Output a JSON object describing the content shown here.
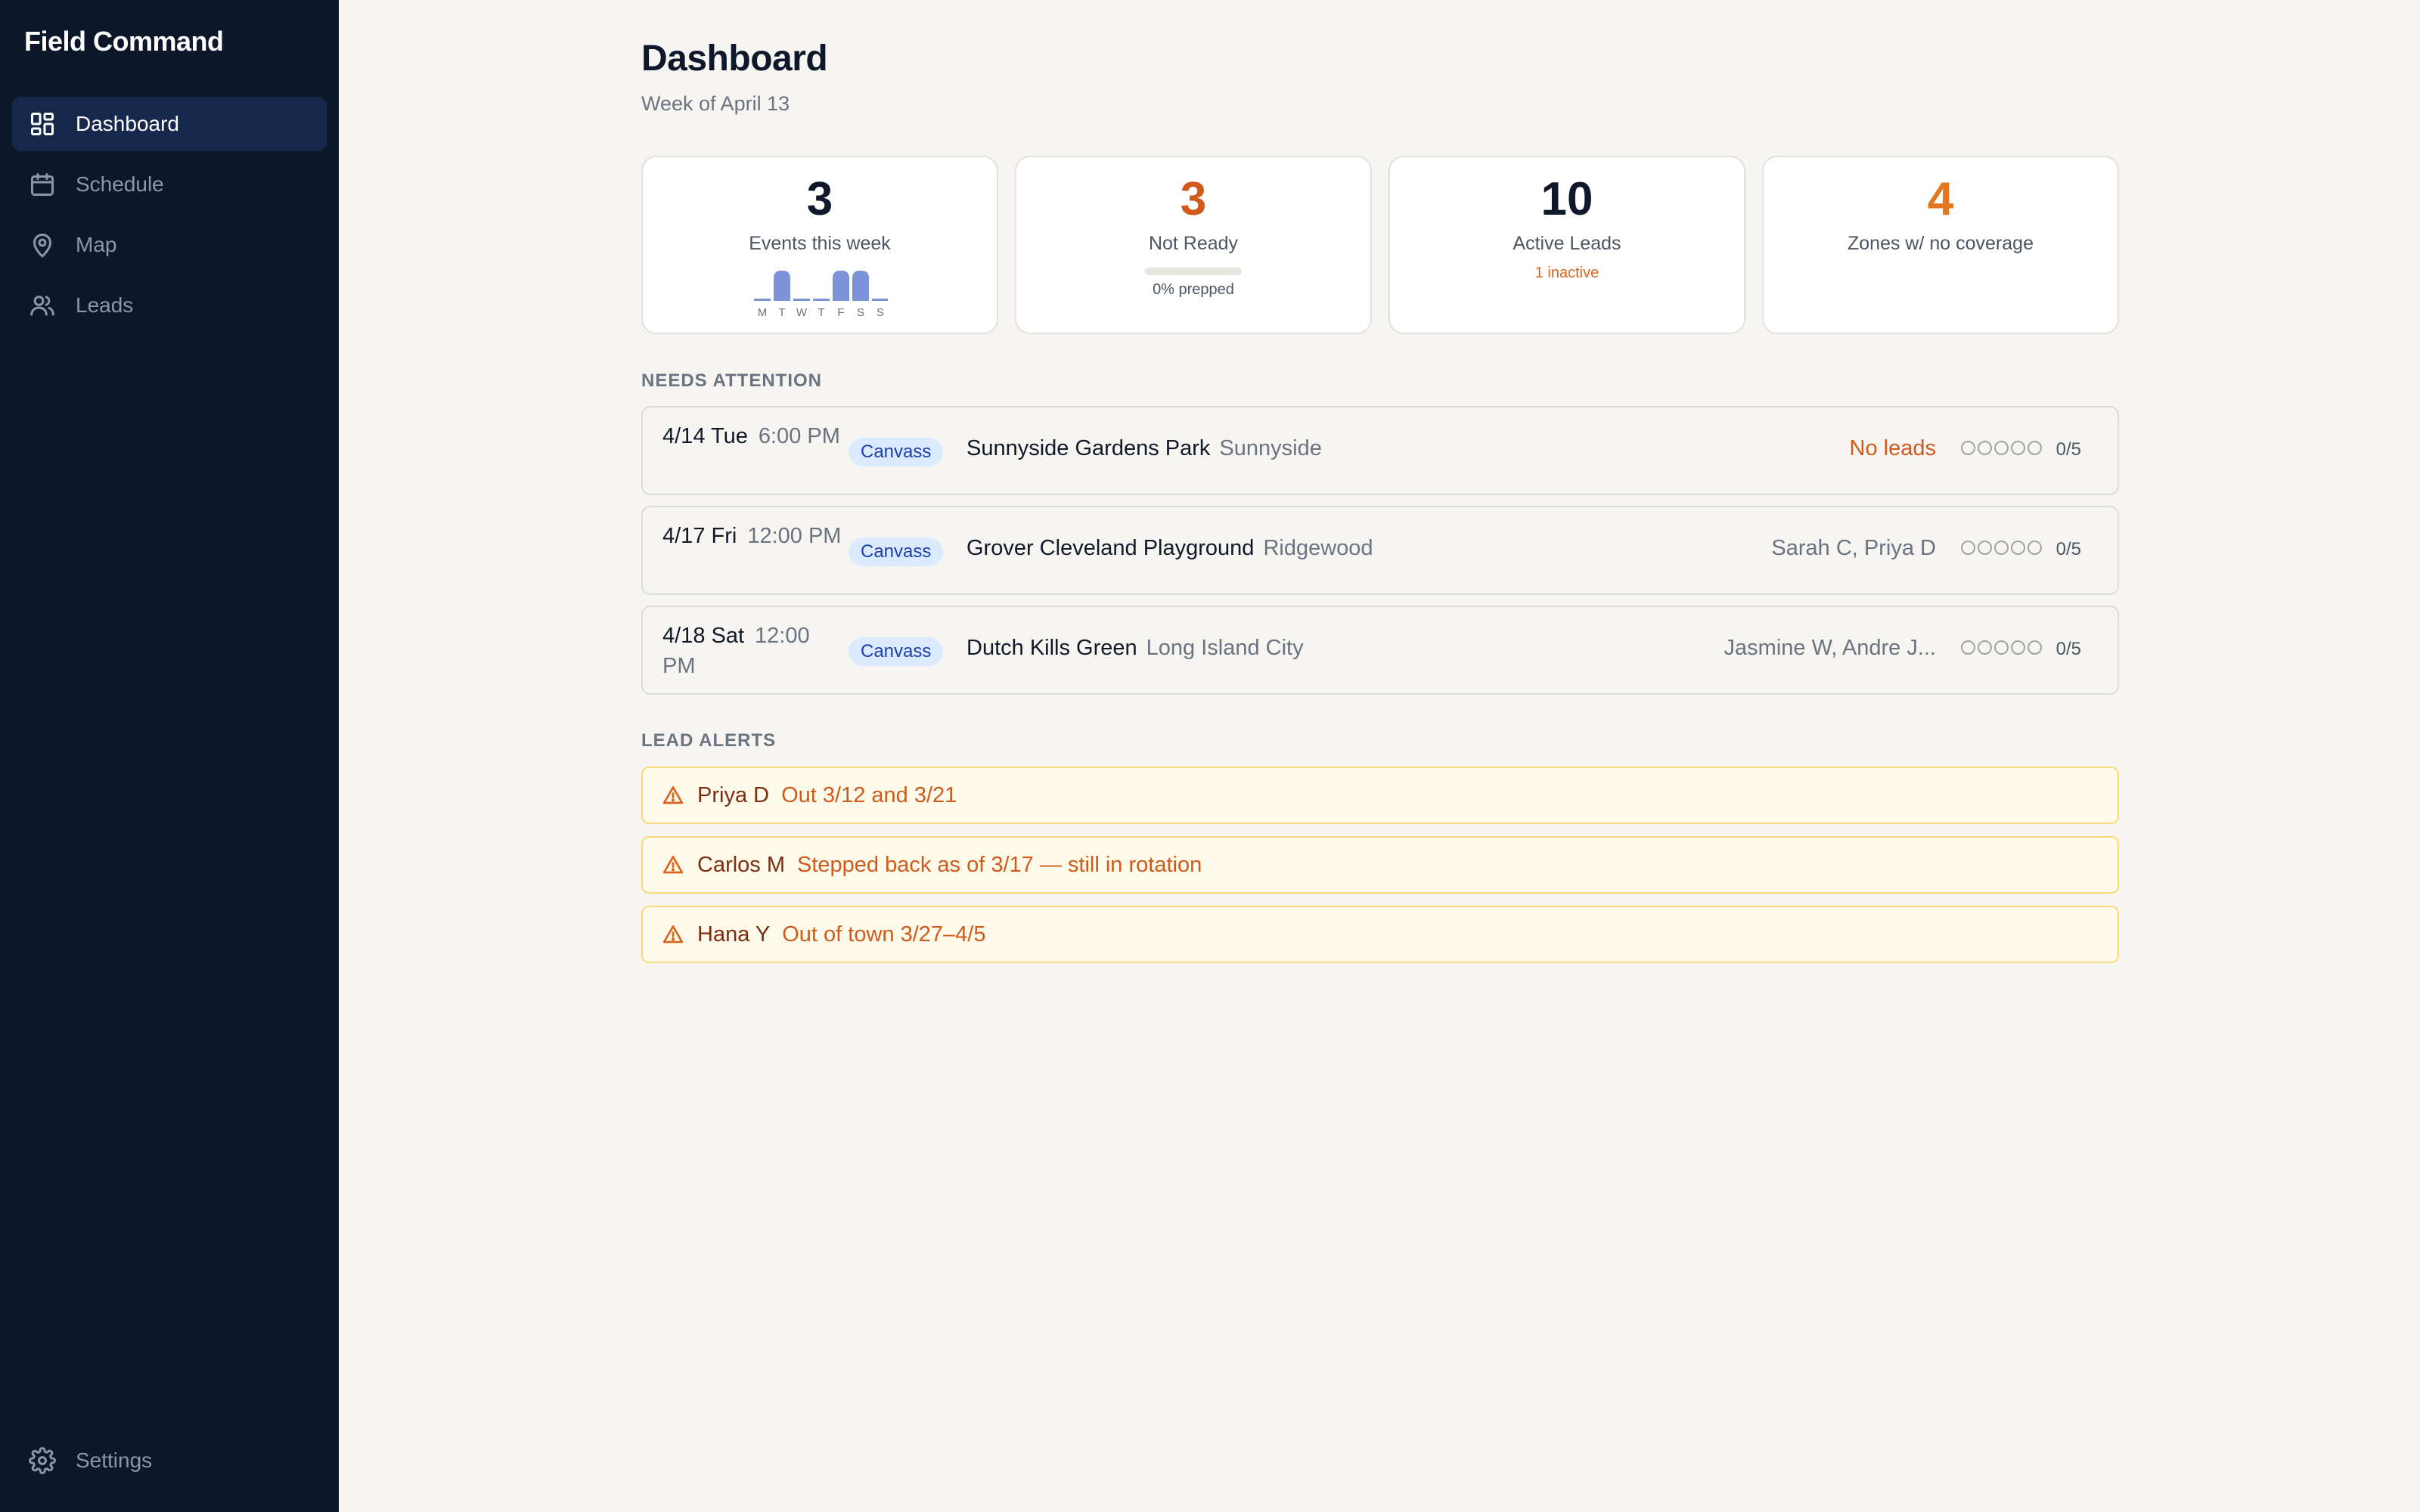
{
  "app": {
    "name": "Field Command"
  },
  "sidebar": {
    "items": [
      {
        "label": "Dashboard",
        "icon": "dashboard-icon",
        "active": true
      },
      {
        "label": "Schedule",
        "icon": "calendar-icon",
        "active": false
      },
      {
        "label": "Map",
        "icon": "map-pin-icon",
        "active": false
      },
      {
        "label": "Leads",
        "icon": "users-icon",
        "active": false
      }
    ],
    "settings_label": "Settings"
  },
  "header": {
    "title": "Dashboard",
    "subtitle": "Week of April 13"
  },
  "stats": {
    "events": {
      "value": "3",
      "label": "Events this week",
      "chart_data": {
        "type": "bar",
        "categories": [
          "M",
          "T",
          "W",
          "T",
          "F",
          "S",
          "S"
        ],
        "values": [
          0,
          1,
          0,
          0,
          1,
          1,
          0
        ]
      }
    },
    "not_ready": {
      "value": "3",
      "label": "Not Ready",
      "progress": 0,
      "progress_label": "0% prepped"
    },
    "active_leads": {
      "value": "10",
      "label": "Active Leads",
      "sub": "1 inactive"
    },
    "zones": {
      "value": "4",
      "label": "Zones w/ no coverage"
    }
  },
  "needs_attention": {
    "heading": "NEEDS ATTENTION",
    "events": [
      {
        "date": "4/14 Tue",
        "time": "6:00 PM",
        "tag": "Canvass",
        "venue": "Sunnyside Gardens Park",
        "neighborhood": "Sunnyside",
        "leads": "No leads",
        "leads_warn": true,
        "filled": 0,
        "score": "0/5"
      },
      {
        "date": "4/17 Fri",
        "time": "12:00 PM",
        "tag": "Canvass",
        "venue": "Grover Cleveland Playground",
        "neighborhood": "Ridgewood",
        "leads": "Sarah C, Priya D",
        "leads_warn": false,
        "filled": 0,
        "score": "0/5"
      },
      {
        "date": "4/18 Sat",
        "time": "12:00 PM",
        "tag": "Canvass",
        "venue": "Dutch Kills Green",
        "neighborhood": "Long Island City",
        "leads": "Jasmine W, Andre J...",
        "leads_warn": false,
        "filled": 0,
        "score": "0/5"
      }
    ]
  },
  "lead_alerts": {
    "heading": "LEAD ALERTS",
    "alerts": [
      {
        "name": "Priya D",
        "message": "Out 3/12 and 3/21"
      },
      {
        "name": "Carlos M",
        "message": "Stepped back as of 3/17 — still in rotation"
      },
      {
        "name": "Hana Y",
        "message": "Out of town 3/27–4/5"
      }
    ]
  },
  "colors": {
    "sidebar_bg": "#0d172a",
    "active_nav_bg": "#16284b",
    "page_bg": "#f6f5f1",
    "accent_orange": "#cf5a1b",
    "chart_bar": "#7b93d8",
    "tag_bg": "#dbeafe",
    "alert_bg": "#fffbeb",
    "alert_border": "#fbd879"
  }
}
